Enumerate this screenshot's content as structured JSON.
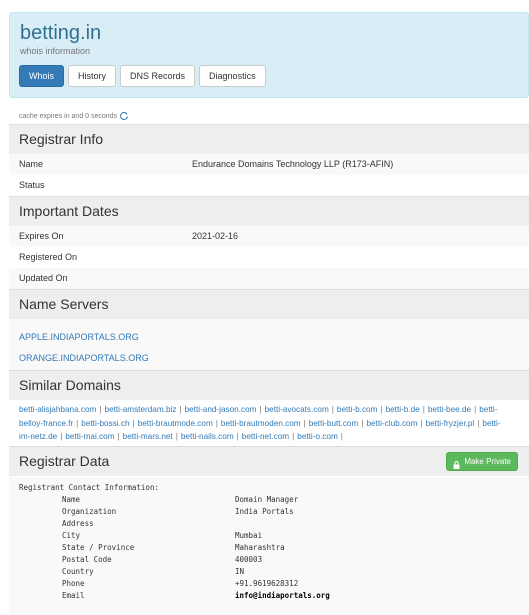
{
  "header": {
    "title": "betting.in",
    "subtitle": "whois information",
    "tabs": [
      "Whois",
      "History",
      "DNS Records",
      "Diagnostics"
    ]
  },
  "cache_text": "cache expires in and 0 seconds",
  "registrar_info": {
    "heading": "Registrar Info",
    "rows": [
      {
        "label": "Name",
        "value": "Endurance Domains Technology LLP (R173-AFIN)"
      },
      {
        "label": "Status",
        "value": ""
      }
    ]
  },
  "important_dates": {
    "heading": "Important Dates",
    "rows": [
      {
        "label": "Expires On",
        "value": "2021-02-16"
      },
      {
        "label": "Registered On",
        "value": ""
      },
      {
        "label": "Updated On",
        "value": ""
      }
    ]
  },
  "name_servers": {
    "heading": "Name Servers",
    "items": [
      "APPLE.INDIAPORTALS.ORG",
      "ORANGE.INDIAPORTALS.ORG"
    ]
  },
  "similar_domains": {
    "heading": "Similar Domains",
    "items": [
      "betti-alisjahbana.com",
      "betti-amsterdam.biz",
      "betti-and-jason.com",
      "betti-avocats.com",
      "betti-b.com",
      "betti-b.de",
      "betti-bee.de",
      "betti-belloy-france.fr",
      "betti-bossi.ch",
      "betti-brautmode.com",
      "betti-brautmoden.com",
      "betti-butt.com",
      "betti-club.com",
      "betti-fryzjer.pl",
      "betti-im-netz.de",
      "betti-mai.com",
      "betti-mars.net",
      "betti-nails.com",
      "betti-net.com",
      "betti-o.com"
    ]
  },
  "registrar_data": {
    "heading": "Registrar Data",
    "make_private_label": "Make Private",
    "raw_title": "Registrant Contact Information:",
    "fields": [
      {
        "label": "Name",
        "value": "Domain Manager"
      },
      {
        "label": "Organization",
        "value": "India Portals"
      },
      {
        "label": "Address",
        "value": ""
      },
      {
        "label": "City",
        "value": "Mumbai"
      },
      {
        "label": "State / Province",
        "value": "Maharashtra"
      },
      {
        "label": "Postal Code",
        "value": "400003"
      },
      {
        "label": "Country",
        "value": "IN"
      },
      {
        "label": "Phone",
        "value": "+91.9619628312"
      },
      {
        "label": "Email",
        "value": "info@indiaportals.org"
      }
    ]
  }
}
